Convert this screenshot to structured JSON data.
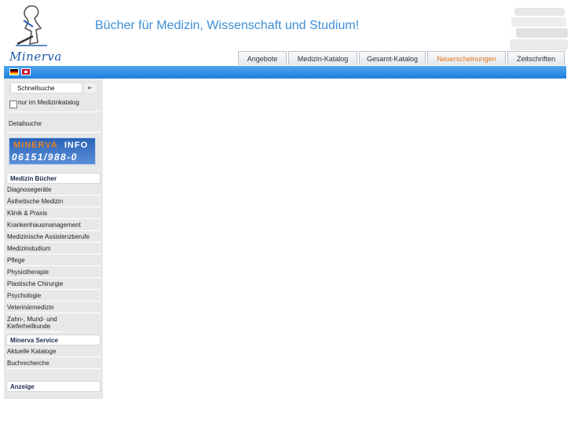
{
  "header": {
    "logo_text": "Minerva",
    "headline": "Bücher für Medizin, Wissenschaft und Studium!"
  },
  "tabs": [
    {
      "label": "Angebote",
      "active": false
    },
    {
      "label": "Medizin-Katalog",
      "active": false
    },
    {
      "label": "Gesamt-Katalog",
      "active": false
    },
    {
      "label": "Neuerscheinungen",
      "active": true
    },
    {
      "label": "Zeitschriften",
      "active": false
    }
  ],
  "sidebar": {
    "search": {
      "value": "Schnellsuche"
    },
    "checkbox_label": "nur im Medizinkatalog",
    "detail_link": "Detailsuche",
    "info_banner": {
      "brand": "MINERVA",
      "info": "INFO",
      "phone": "06151/988-0"
    },
    "sections": {
      "medizin": {
        "title": "Medizin Bücher",
        "items": [
          "Diagnosegeräte",
          "Ästhetische Medizin",
          "Klinik & Praxis",
          "Krankenhausmanagement",
          "Medizinische Assistenzberufe",
          "Medizinstudium",
          "Pflege",
          "Physiotherapie",
          "Plastische Chirurgie",
          "Psychologie",
          "Veterinärmedizin",
          "Zahn-, Mund- und Kieferheilkunde"
        ]
      },
      "service": {
        "title": "Minerva Service",
        "items": [
          "Aktuelle Kataloge",
          "Buchrecherche"
        ]
      },
      "anzeige": {
        "title": "Anzeige"
      }
    }
  },
  "colors": {
    "accent_blue": "#2a86e0",
    "headline_blue": "#3d8fd6",
    "active_tab": "#e8761a"
  }
}
